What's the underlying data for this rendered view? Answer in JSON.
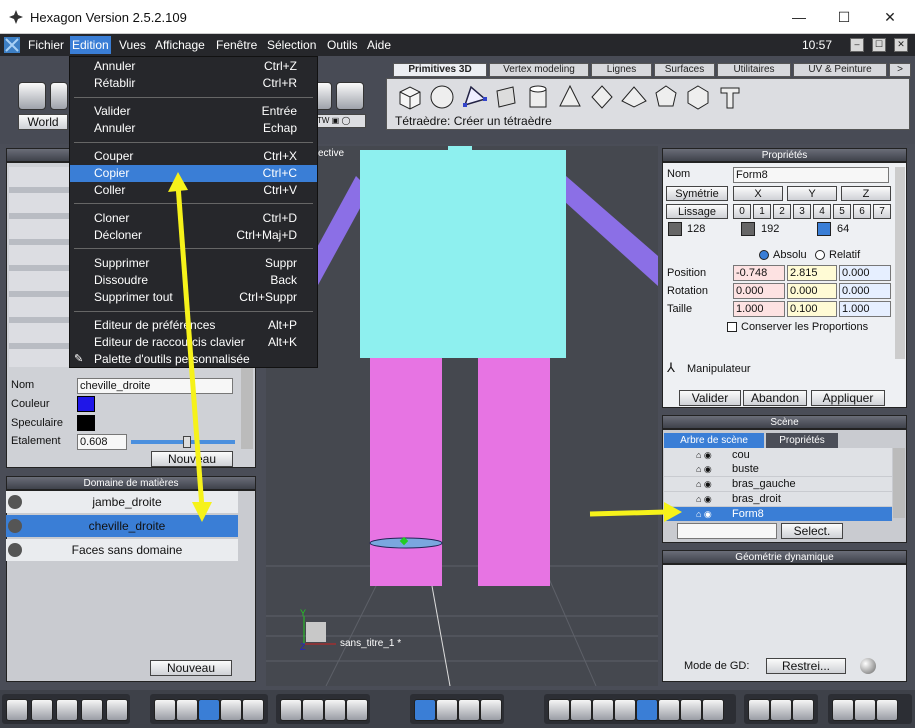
{
  "window": {
    "title": "Hexagon Version 2.5.2.109",
    "minimize": "—",
    "maximize": "☐",
    "close": "✕"
  },
  "menubar": {
    "items": [
      "Fichier",
      "Edition",
      "Vues",
      "Affichage",
      "Fenêtre",
      "Sélection",
      "Outils",
      "Aide"
    ],
    "time": "10:57"
  },
  "edit_menu": {
    "items": [
      {
        "label": "Annuler",
        "shortcut": "Ctrl+Z"
      },
      {
        "label": "Rétablir",
        "shortcut": "Ctrl+R"
      },
      {
        "label": "Valider",
        "shortcut": "Entrée"
      },
      {
        "label": "Annuler",
        "shortcut": "Echap"
      },
      {
        "label": "Couper",
        "shortcut": "Ctrl+X"
      },
      {
        "label": "Copier",
        "shortcut": "Ctrl+C"
      },
      {
        "label": "Coller",
        "shortcut": "Ctrl+V"
      },
      {
        "label": "Cloner",
        "shortcut": "Ctrl+D"
      },
      {
        "label": "Décloner",
        "shortcut": "Ctrl+Maj+D"
      },
      {
        "label": "Supprimer",
        "shortcut": "Suppr"
      },
      {
        "label": "Dissoudre",
        "shortcut": "Back"
      },
      {
        "label": "Supprimer tout",
        "shortcut": "Ctrl+Suppr"
      },
      {
        "label": "Editeur de préférences",
        "shortcut": "Alt+P"
      },
      {
        "label": "Editeur de raccourcis clavier",
        "shortcut": "Alt+K"
      },
      {
        "label": "Palette d'outils personnalisée",
        "shortcut": ""
      }
    ],
    "selected": "Copier"
  },
  "toolbar": {
    "world_button": "World",
    "tabs": [
      "Primitives 3D",
      "Vertex modeling",
      "Lignes",
      "Surfaces",
      "Utilitaires",
      "UV & Peinture"
    ],
    "active_tab": "Primitives 3D",
    "status": "Tétraèdre: Créer un tétraèdre",
    "primitive_icons": [
      "cube-icon",
      "sphere-icon",
      "tetrahedron-icon",
      "plane-icon",
      "cylinder-icon",
      "cone-icon",
      "octahedron-icon",
      "pyramid-icon",
      "dodecahedron-icon",
      "icosahedron-icon",
      "text-primitive-icon"
    ]
  },
  "viewport": {
    "label": "ective",
    "scene_name": "sans_titre_1 *",
    "axis_y": "Y",
    "axis_z": "Z"
  },
  "material": {
    "nom_label": "Nom",
    "nom_value": "cheville_droite",
    "couleur_label": "Couleur",
    "speculaire_label": "Speculaire",
    "etalement_label": "Etalement",
    "etalement_value": "0.608",
    "nouveau": "Nouveau"
  },
  "domaines": {
    "title": "Domaine de matières",
    "items": [
      "jambe_droite",
      "cheville_droite",
      "Faces sans domaine"
    ],
    "selected": "cheville_droite",
    "nouveau": "Nouveau"
  },
  "proprietes": {
    "title": "Propriétés",
    "nom_label": "Nom",
    "nom_value": "Form8",
    "symetrie": "Symétrie",
    "x": "X",
    "y": "Y",
    "z": "Z",
    "lissage": "Lissage",
    "lissage_levels": [
      "0",
      "1",
      "2",
      "3",
      "4",
      "5",
      "6",
      "7"
    ],
    "counts": [
      "128",
      "192",
      "64"
    ],
    "absolu": "Absolu",
    "relatif": "Relatif",
    "position_label": "Position",
    "position": [
      "-0.748",
      "2.815",
      "0.000"
    ],
    "rotation_label": "Rotation",
    "rotation": [
      "0.000",
      "0.000",
      "0.000"
    ],
    "taille_label": "Taille",
    "taille": [
      "1.000",
      "0.100",
      "1.000"
    ],
    "conserver": "Conserver les Proportions",
    "manipulateur": "Manipulateur",
    "valider": "Valider",
    "abandon": "Abandon",
    "appliquer": "Appliquer"
  },
  "scene": {
    "title": "Scène",
    "tabs": [
      "Arbre de scène",
      "Propriétés"
    ],
    "items": [
      "cou",
      "buste",
      "bras_gauche",
      "bras_droit",
      "Form8"
    ],
    "selected": "Form8",
    "select_button": "Select."
  },
  "geometrie": {
    "title": "Géométrie dynamique",
    "mode_label": "Mode de GD:",
    "mode_value": "Restrei..."
  },
  "colors": {
    "accent": "#3a7ed6",
    "menubar": "#26272b",
    "torso": "#8ef0ef",
    "legs": "#e774e3",
    "arms": "#8b6fe6",
    "arrow": "#f6f21a"
  }
}
